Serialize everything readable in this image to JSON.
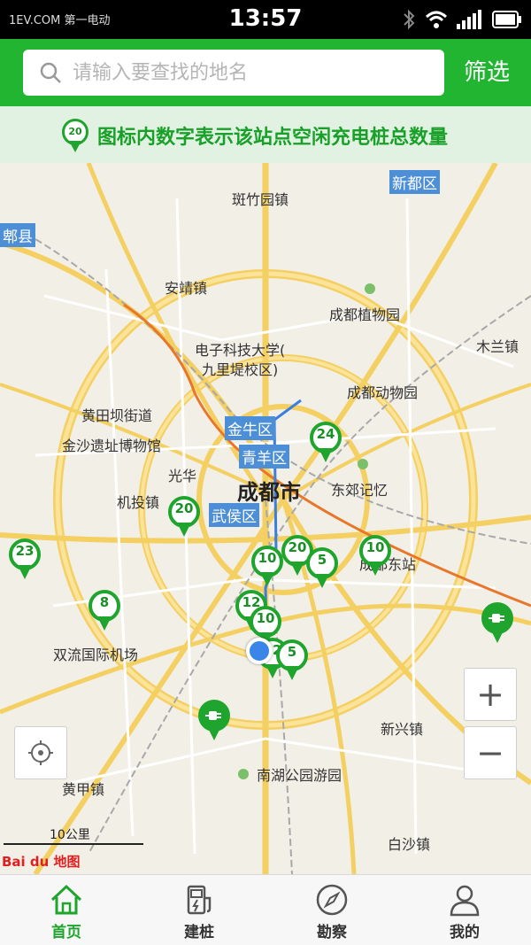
{
  "status_bar": {
    "carrier": "1EV.COM 第一电动",
    "time": "13:57"
  },
  "search": {
    "placeholder": "请输入要查找的地名",
    "filter_label": "筛选"
  },
  "banner": {
    "pin_number": "20",
    "text": "图标内数字表示该站点空闲充电桩总数量"
  },
  "map": {
    "places": [
      {
        "name": "斑竹园镇"
      },
      {
        "name": "新都区"
      },
      {
        "name": "郫县"
      },
      {
        "name": "安靖镇"
      },
      {
        "name": "成都植物园"
      },
      {
        "name": "木兰镇"
      },
      {
        "name": "电子科技大学("
      },
      {
        "name": "九里堤校区)"
      },
      {
        "name": "成都动物园"
      },
      {
        "name": "黄田坝街道"
      },
      {
        "name": "金沙遗址博物馆"
      },
      {
        "name": "光华"
      },
      {
        "name": "东郊记忆"
      },
      {
        "name": "机投镇"
      },
      {
        "name": "成都东站"
      },
      {
        "name": "双流国际机场"
      },
      {
        "name": "新兴镇"
      },
      {
        "name": "南湖公园游园"
      },
      {
        "name": "黄甲镇"
      },
      {
        "name": "白沙镇"
      }
    ],
    "city": "成都市",
    "districts": [
      "金牛区",
      "青羊区",
      "武侯区"
    ],
    "stations": [
      "24",
      "20",
      "23",
      "10",
      "20",
      "5",
      "10",
      "8",
      "12",
      "10",
      "22",
      "5"
    ],
    "zoom_in_label": "+",
    "zoom_out_label": "−",
    "scale": "10公里",
    "logo": "Bai du 地图"
  },
  "tabs": [
    {
      "label": "首页",
      "icon": "home-icon",
      "active": true
    },
    {
      "label": "建桩",
      "icon": "charger-icon",
      "active": false
    },
    {
      "label": "勘察",
      "icon": "compass-icon",
      "active": false
    },
    {
      "label": "我的",
      "icon": "user-icon",
      "active": false
    }
  ],
  "colors": {
    "brand_green": "#21b532",
    "pin_green": "#1fa52d",
    "district_blue": "#4d8fd6"
  }
}
